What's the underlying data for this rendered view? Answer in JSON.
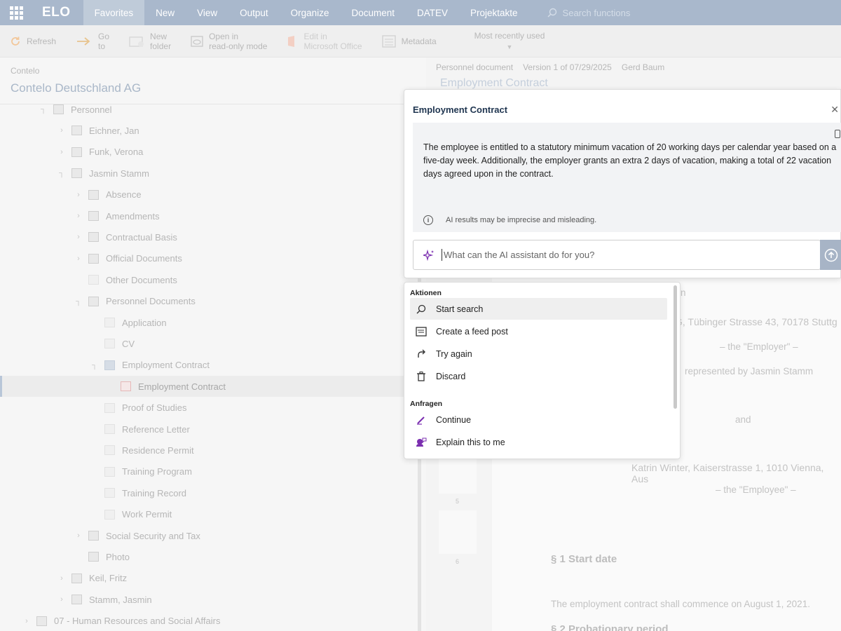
{
  "app": {
    "logo": "ELO"
  },
  "nav": {
    "tabs": [
      "Favorites",
      "New",
      "View",
      "Output",
      "Organize",
      "Document",
      "DATEV",
      "Projektakte"
    ],
    "active_tab": "Favorites",
    "search_placeholder": "Search functions"
  },
  "ribbon": {
    "refresh": "Refresh",
    "goto_1": "Go",
    "goto_2": "to",
    "newfolder_1": "New",
    "newfolder_2": "folder",
    "readonly_1": "Open in",
    "readonly_2": "read-only mode",
    "edit_1": "Edit in",
    "edit_2": "Microsoft Office",
    "metadata": "Metadata",
    "recent": "Most recently used"
  },
  "tree": {
    "crumb": "Contelo",
    "repository": "Contelo Deutschland AG",
    "items": [
      {
        "label": "Personnel",
        "level": 0,
        "toggle": "collapse",
        "icon": "org"
      },
      {
        "label": "Eichner, Jan",
        "level": 1,
        "toggle": "expand",
        "icon": "folder-person"
      },
      {
        "label": "Funk, Verona",
        "level": 1,
        "toggle": "expand",
        "icon": "folder-person"
      },
      {
        "label": "Jasmin Stamm",
        "level": 1,
        "toggle": "collapse",
        "icon": "folder-person"
      },
      {
        "label": "Absence",
        "level": 2,
        "toggle": "expand",
        "icon": "binder"
      },
      {
        "label": "Amendments",
        "level": 2,
        "toggle": "expand",
        "icon": "calendar"
      },
      {
        "label": "Contractual Basis",
        "level": 2,
        "toggle": "expand",
        "icon": "binder"
      },
      {
        "label": "Official Documents",
        "level": 2,
        "toggle": "expand",
        "icon": "binder"
      },
      {
        "label": "Other Documents",
        "level": 2,
        "toggle": "",
        "icon": "doc"
      },
      {
        "label": "Personnel Documents",
        "level": 2,
        "toggle": "collapse",
        "icon": "binder"
      },
      {
        "label": "Application",
        "level": 3,
        "toggle": "",
        "icon": "doc"
      },
      {
        "label": "CV",
        "level": 3,
        "toggle": "",
        "icon": "doc"
      },
      {
        "label": "Employment Contract",
        "level": 3,
        "toggle": "collapse",
        "icon": "folder-blue"
      },
      {
        "label": "Employment Contract",
        "level": 4,
        "toggle": "",
        "icon": "pdf",
        "selected": true
      },
      {
        "label": "Proof of Studies",
        "level": 3,
        "toggle": "",
        "icon": "doc"
      },
      {
        "label": "Reference Letter",
        "level": 3,
        "toggle": "",
        "icon": "doc"
      },
      {
        "label": "Residence Permit",
        "level": 3,
        "toggle": "",
        "icon": "doc"
      },
      {
        "label": "Training Program",
        "level": 3,
        "toggle": "",
        "icon": "doc"
      },
      {
        "label": "Training Record",
        "level": 3,
        "toggle": "",
        "icon": "doc"
      },
      {
        "label": "Work Permit",
        "level": 3,
        "toggle": "",
        "icon": "doc"
      },
      {
        "label": "Social Security and Tax",
        "level": 2,
        "toggle": "expand",
        "icon": "binder"
      },
      {
        "label": "Photo",
        "level": 2,
        "toggle": "",
        "icon": "photo"
      },
      {
        "label": "Keil, Fritz",
        "level": 1,
        "toggle": "expand",
        "icon": "folder-person"
      },
      {
        "label": "Stamm, Jasmin",
        "level": 1,
        "toggle": "expand",
        "icon": "folder-person"
      },
      {
        "label": "07 - Human Resources and Social Affairs",
        "level": 0,
        "toggle": "expand",
        "icon": "binder",
        "root": true
      }
    ]
  },
  "preview": {
    "doc_type": "Personnel document",
    "version": "Version 1 of 07/29/2025",
    "author": "Gerd Baum",
    "title": "Employment Contract",
    "page_lines": {
      "n_frag": "n",
      "employer_addr": "G, Tübinger Strasse 43, 70178 Stuttg",
      "employer_role": "– the \"Employer\" –",
      "represented": "represented by Jasmin Stamm",
      "and": "and",
      "employee_addr": "Katrin Winter, Kaiserstrasse 1, 1010 Vienna, Aus",
      "employee_role": "– the \"Employee\" –",
      "section1": "§ 1 Start date",
      "section1_text": "The employment contract shall commence on August 1, 2021.",
      "section2": "§ 2 Probationary period"
    },
    "page_numbers": [
      "5",
      "6"
    ]
  },
  "ai_dialog": {
    "title": "Employment Contract",
    "result_text": "The employee is entitled to a statutory minimum vacation of 20 working days per calendar year based on a five-day week. Additionally, the employer grants an extra 2 days of vacation, making a total of 22 vacation days agreed upon in the contract.",
    "disclaimer": "AI results may be imprecise and misleading.",
    "input_placeholder": "What can the AI assistant do for you?"
  },
  "menu": {
    "section1": "Aktionen",
    "actions": [
      "Start search",
      "Create a feed post",
      "Try again",
      "Discard"
    ],
    "section2": "Anfragen",
    "requests": [
      "Continue",
      "Explain this to me"
    ]
  },
  "colors": {
    "nav_bg": "#a9b8cc",
    "accent": "#1f3550",
    "ai_purple": "#7b2fb0"
  }
}
